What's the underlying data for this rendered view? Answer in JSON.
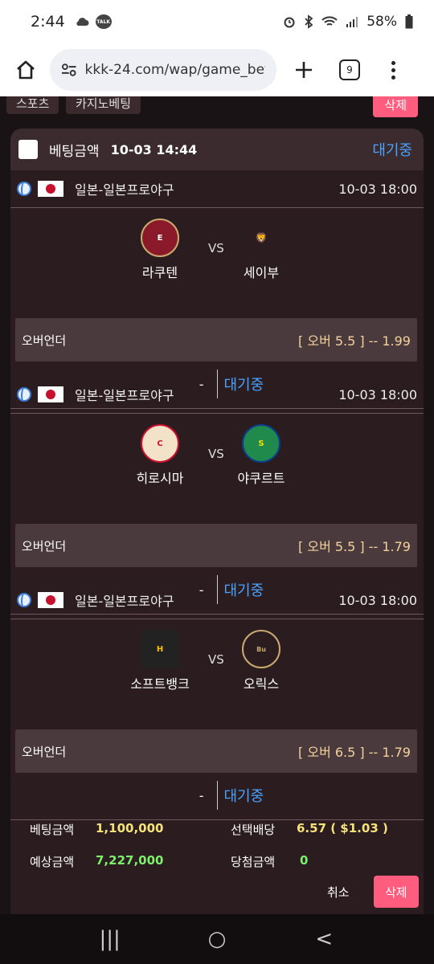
{
  "status_bar": {
    "time": "2:44",
    "talk_badge": "TALK",
    "battery": "58%"
  },
  "browser": {
    "url": "kkk-24.com/wap/game_bet",
    "tab_count": "9"
  },
  "topnav": {
    "tab1": "스포츠",
    "tab2": "카지노베팅",
    "delete": "삭제"
  },
  "slip": {
    "label": "베팅금액",
    "date": "10-03 14:44",
    "status": "대기중",
    "games": [
      {
        "league": "일본-일본프로야구",
        "time": "10-03 18:00",
        "home": "라쿠텐",
        "home_logo_text": "RAKUTEN EAGLES",
        "away": "세이부",
        "away_logo_text": "Lions",
        "vs": "VS",
        "market": "오버언더",
        "odds": "[ 오버 5.5 ] -- 1.99",
        "result": "-",
        "result_status": "대기중"
      },
      {
        "league": "일본-일본프로야구",
        "time": "10-03 18:00",
        "home": "히로시마",
        "home_logo_text": "Carp",
        "away": "야쿠르트",
        "away_logo_text": "S",
        "vs": "VS",
        "market": "오버언더",
        "odds": "[ 오버 5.5 ] -- 1.79",
        "result": "-",
        "result_status": "대기중"
      },
      {
        "league": "일본-일본프로야구",
        "time": "10-03 18:00",
        "home": "소프트뱅크",
        "home_logo_text": "H",
        "away": "오릭스",
        "away_logo_text": "Buffaloes",
        "vs": "VS",
        "market": "오버언더",
        "odds": "[ 오버 6.5 ] -- 1.79",
        "result": "-",
        "result_status": "대기중"
      }
    ],
    "summary": {
      "bet_amount_label": "베팅금액",
      "bet_amount": "1,100,000",
      "odds_label": "선택배당",
      "odds": "6.57 ( $1.03 )",
      "expected_label": "예상금액",
      "expected": "7,227,000",
      "win_label": "당첨금액",
      "win": "0"
    },
    "cancel_label": "취소",
    "delete_label": "삭제"
  },
  "nav": {
    "recents": "|||",
    "home": "○",
    "back": "<"
  }
}
